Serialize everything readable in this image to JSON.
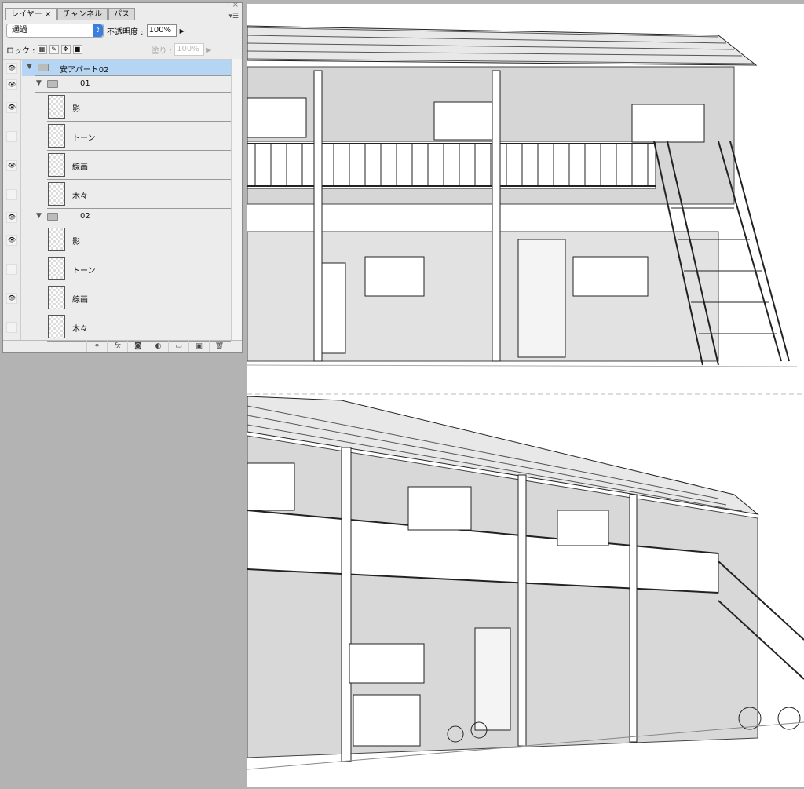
{
  "panel": {
    "tabs": [
      {
        "label": "レイヤー ×"
      },
      {
        "label": "チャンネル"
      },
      {
        "label": "パス"
      }
    ],
    "blend_mode": "通過",
    "opacity_label": "不透明度 :",
    "opacity_value": "100%",
    "lock_label": "ロック :",
    "fill_label": "塗り :",
    "fill_value": "100%",
    "layers": [
      {
        "name": "安アパート02",
        "type": "group",
        "visible": true,
        "level": 0,
        "selected": true
      },
      {
        "name": "01",
        "type": "group",
        "visible": true,
        "level": 1
      },
      {
        "name": "影",
        "type": "layer",
        "visible": true
      },
      {
        "name": "トーン",
        "type": "layer",
        "visible": false
      },
      {
        "name": "線画",
        "type": "layer",
        "visible": true
      },
      {
        "name": "木々",
        "type": "layer",
        "visible": false
      },
      {
        "name": "02",
        "type": "group",
        "visible": true,
        "level": 1
      },
      {
        "name": "影",
        "type": "layer",
        "visible": true
      },
      {
        "name": "トーン",
        "type": "layer",
        "visible": false
      },
      {
        "name": "線画",
        "type": "layer",
        "visible": true
      },
      {
        "name": "木々",
        "type": "layer",
        "visible": false
      }
    ],
    "footer_icons": [
      "link-icon",
      "fx-icon",
      "mask-icon",
      "adjustment-icon",
      "folder-icon",
      "new-layer-icon",
      "trash-icon"
    ]
  }
}
